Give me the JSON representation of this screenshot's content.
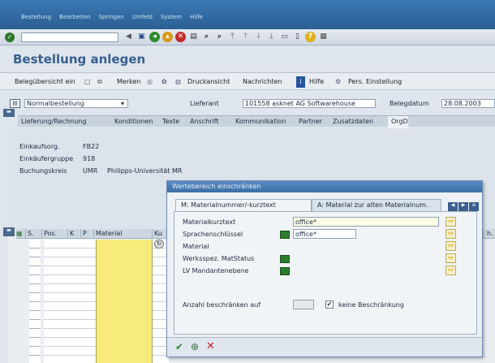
{
  "menubar": {
    "items": [
      "Bestellung",
      "Bearbeiten",
      "Springen",
      "Umfeld",
      "System",
      "Hilfe"
    ]
  },
  "title": "Bestellung anlegen",
  "app_toolbar": {
    "beleg": "Belegübersicht ein",
    "merken": "Merken",
    "druck": "Druckansicht",
    "nachrichten": "Nachrichten",
    "hilfe": "Hilfe",
    "pers": "Pers. Einstellung"
  },
  "header": {
    "doctype": "Normalbestellung",
    "lieferant_label": "Lieferant",
    "lieferant_value": "101558 asknet AG Softwarehouse",
    "belegdatum_label": "Belegdatum",
    "belegdatum_value": "28.08.2003"
  },
  "tabs": [
    "Lieferung/Rechnung",
    "Konditionen",
    "Texte",
    "Anschrift",
    "Kommunikation",
    "Partner",
    "Zusatzdaten",
    "OrgD"
  ],
  "org": {
    "einkaufsorg_label": "Einkaufsorg.",
    "einkaufsorg_value": "FB22",
    "einkaufergruppe_label": "Einkäufergruppe",
    "einkaufergruppe_value": "918",
    "buchungskreis_label": "Buchungskreis",
    "buchungskreis_value": "UMR",
    "buchungskreis_name": "Philipps-Universität MR"
  },
  "grid": {
    "headers": [
      "S.",
      "Pos.",
      "K",
      "P",
      "Material",
      "Ku"
    ],
    "right_header": "h."
  },
  "dialog": {
    "title": "Wertebereich einschränken",
    "tab1": "M: Materialnummer/-kurztext",
    "tab2": "A: Material zur alten Materialnum.",
    "fields": {
      "kurztext_label": "Materialkurztext",
      "kurztext_value": "office*",
      "sprache_label": "Sprachenschlüssel",
      "sprache_value": "office*",
      "material_label": "Material",
      "werk_label": "Werksspez. MatStatus",
      "lv_label": "LV Mandantenebene"
    },
    "limit_label": "Anzahl beschränken auf",
    "limit_value": "",
    "no_limit_label": "keine Beschränkung"
  },
  "colors": {
    "accent": "#3a79b4",
    "yellow": "#f7ec7b",
    "title": "#375f90"
  }
}
